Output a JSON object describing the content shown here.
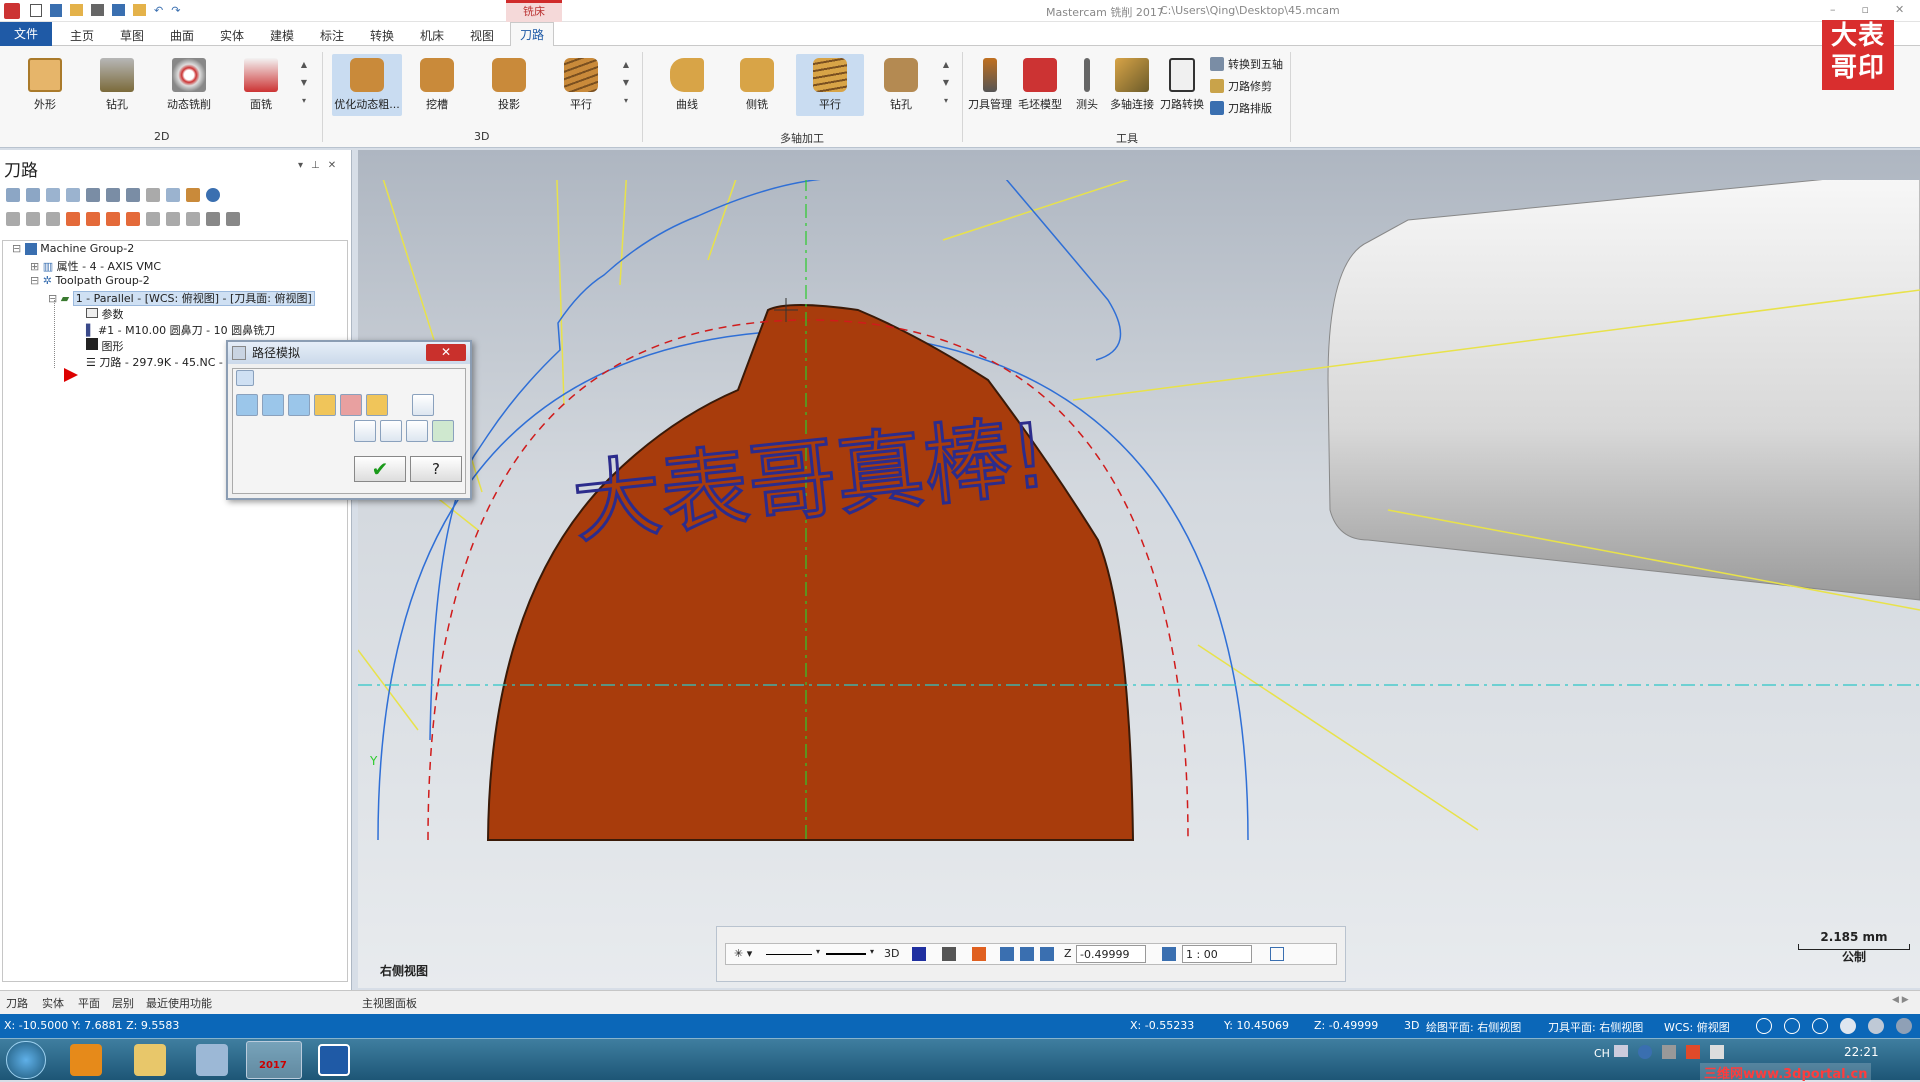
{
  "title": {
    "app": "Mastercam 铣削 2017",
    "path": "C:\\Users\\Qing\\Desktop\\45.mcam",
    "context_tab": "铣床"
  },
  "menu": {
    "file": "文件",
    "items": [
      "主页",
      "草图",
      "曲面",
      "实体",
      "建模",
      "标注",
      "转换",
      "机床",
      "视图"
    ],
    "active": "刀路"
  },
  "ribbon": {
    "g2d": {
      "name": "2D",
      "buttons": [
        "外形",
        "钻孔",
        "动态铣削",
        "面铣"
      ]
    },
    "g3d": {
      "name": "3D",
      "buttons": [
        "优化动态粗...",
        "挖槽",
        "投影",
        "平行"
      ]
    },
    "gmulti": {
      "name": "多轴加工",
      "buttons": [
        "曲线",
        "侧铣",
        "平行",
        "钻孔"
      ]
    },
    "gtools": {
      "name": "工具",
      "buttons": [
        "刀具管理",
        "毛坯模型",
        "测头",
        "多轴连接",
        "刀路转换"
      ],
      "small": [
        "转换到五轴",
        "刀路修剪",
        "刀路排版"
      ]
    }
  },
  "logo": {
    "line1": "大表",
    "line2": "哥印"
  },
  "panel": {
    "title": "刀路",
    "tree": [
      "Machine Group-2",
      "属性 - 4 - AXIS VMC",
      "Toolpath Group-2",
      "1 - Parallel - [WCS: 俯视图] - [刀具面: 俯视图]",
      "参数",
      "#1 - M10.00 圆鼻刀 - 10 圆鼻铣刀",
      "图形",
      "刀路 - 297.9K - 45.NC - 程"
    ]
  },
  "dialog": {
    "title": "路径模拟"
  },
  "viewport": {
    "engraving": "大表哥真棒!",
    "view_label": "右侧视图",
    "axis_label": "Z",
    "axis_label2": "Y",
    "scale": "2.185 mm",
    "unit": "公制"
  },
  "snapbar": {
    "mode3d": "3D",
    "z_label": "Z",
    "z_value": "-0.49999",
    "scale_value": "1 : 00"
  },
  "bottom_tabs": [
    "刀路",
    "实体",
    "平面",
    "层别",
    "最近使用功能"
  ],
  "viewport_tab": "主视图面板",
  "status": {
    "cursor_left": "X: -10.5000   Y: 7.6881   Z: 9.5583",
    "x": "X:   -0.55233",
    "y": "Y:   10.45069",
    "z": "Z:   -0.49999",
    "mode": "3D",
    "plane": "绘图平面: 右侧视图",
    "tool_plane": "刀具平面: 右侧视图",
    "wcs": "WCS: 俯视图"
  },
  "taskbar": {
    "clock": "22:21",
    "lang": "CH",
    "mastercam": "2017",
    "watermark": "三维网www.3dportal.cn"
  },
  "colors": {
    "stock": "#a83c0c",
    "toolpath": "#2f6fd6",
    "accent": "#1f5aa6"
  }
}
